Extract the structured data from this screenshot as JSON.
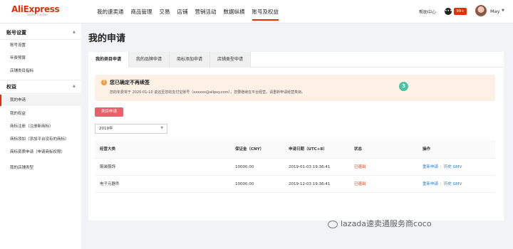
{
  "header": {
    "logo": "AliExpress",
    "logo_sub": "Seller Center",
    "nav": [
      "我的速卖通",
      "商品管理",
      "交易",
      "店铺",
      "营销活动",
      "数据纵横",
      "账号及权益"
    ],
    "help": "帮助中心",
    "msg_badge": "99+",
    "username": "May"
  },
  "sidebar": {
    "section1_title": "账号设置",
    "section1_items": [
      "账号设置",
      "年费预算",
      "店铺类目指标"
    ],
    "section2_title": "权益",
    "section2_items": [
      "我的申请",
      "我的权益",
      "商标注册（注册新商标）",
      "商标添加（添加平台没有的商标）",
      "商标资质申请（申请商标权限）",
      "我的店铺类型"
    ]
  },
  "main": {
    "title": "我的申请",
    "tabs": [
      "我的类目申请",
      "我的品牌申请",
      "商标添加申请",
      "店铺类型申请"
    ],
    "notice_title": "您已确定不再续签",
    "notice_text": "您的年费将于 2020-01-10 返还至您的支付宝账号（xxxxxx@alipay.com），您要继续在平台经营，请重新申请经营类目。",
    "step": "3",
    "apply_button": "类目申请",
    "year": "2019年",
    "columns": [
      "经营大类",
      "保证金（CNY）",
      "申请日期（UTC+8）",
      "状态",
      "操作"
    ],
    "rows": [
      {
        "category": "服装服饰",
        "deposit": "10000.00",
        "date": "2019-01-03 19:36:41",
        "status": "已退出",
        "action1": "重新申请",
        "action2": "历史 GMV"
      },
      {
        "category": "电子元器件",
        "deposit": "10000.00",
        "date": "2019-12-03 19:36:41",
        "status": "已退出",
        "action1": "重新申请",
        "action2": "历史 GMV"
      }
    ],
    "action_sep": "|"
  },
  "watermark": "lazada速卖通服务商coco",
  "colors": {
    "accent": "#e62e04",
    "link": "#2a7fd4",
    "notice_bg": "#fdf1e5",
    "step_green": "#4cc2a0"
  }
}
